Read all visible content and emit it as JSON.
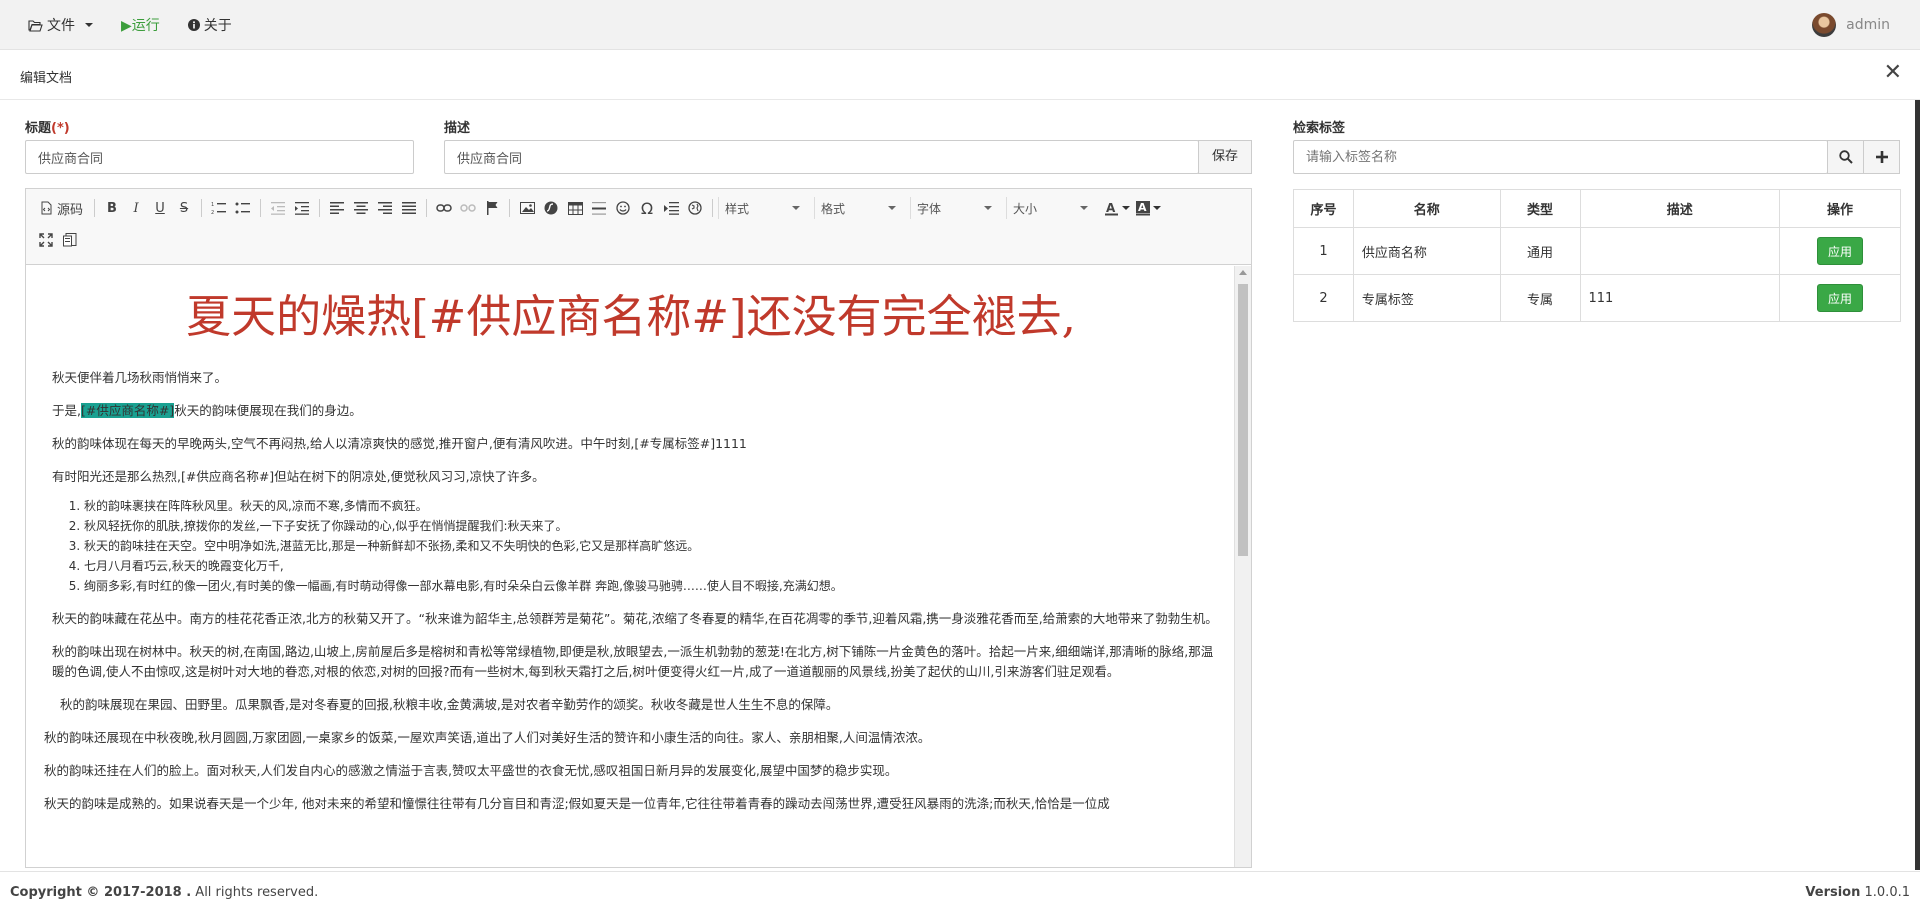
{
  "topbar": {
    "file_label": "文件",
    "run_label": "▶运行",
    "about_label": "关于",
    "user_name": "admin"
  },
  "dialog": {
    "title": "编辑文档",
    "close_label": "✕"
  },
  "form": {
    "title_label": "标题",
    "title_required": "(*)",
    "title_value": "供应商合同",
    "desc_label": "描述",
    "desc_value": "供应商合同",
    "save_label": "保存"
  },
  "editor": {
    "source_label": "源码",
    "combo_style": "样式",
    "combo_format": "格式",
    "combo_font": "字体",
    "combo_size": "大小",
    "heading": "夏天的燥热[#供应商名称#]还没有完全褪去,",
    "p1": "秋天便伴着几场秋雨悄悄来了。",
    "p2_before": "于是,",
    "p2_highlight": "[#供应商名称#]",
    "p2_after": "秋天的韵味便展现在我们的身边。",
    "p3": "秋的韵味体现在每天的早晚两头,空气不再闷热,给人以清凉爽快的感觉,推开窗户,便有清风吹进。中午时刻,[#专属标签#]1111",
    "p4": "有时阳光还是那么热烈,[#供应商名称#]但站在树下的阴凉处,便觉秋风习习,凉快了许多。",
    "list": [
      "秋的韵味裹挟在阵阵秋风里。秋天的风,凉而不寒,多情而不疯狂。",
      "秋风轻抚你的肌肤,撩拨你的发丝,一下子安抚了你躁动的心,似乎在悄悄提醒我们:秋天来了。",
      "秋天的韵味挂在天空。空中明净如洗,湛蓝无比,那是一种新鲜却不张扬,柔和又不失明快的色彩,它又是那样高旷悠远。",
      "七月八月看巧云,秋天的晚霞变化万千,",
      "绚丽多彩,有时红的像一团火,有时美的像一幅画,有时萌动得像一部水幕电影,有时朵朵白云像羊群 奔跑,像骏马驰骋……使人目不暇接,充满幻想。"
    ],
    "p5": "秋天的韵味藏在花丛中。南方的桂花花香正浓,北方的秋菊又开了。“秋来谁为韶华主,总领群芳是菊花”。菊花,浓缩了冬春夏的精华,在百花凋零的季节,迎着风霜,携一身淡雅花香而至,给萧索的大地带来了勃勃生机。",
    "p6": "秋的韵味出现在树林中。秋天的树,在南国,路边,山坡上,房前屋后多是榕树和青松等常绿植物,即便是秋,放眼望去,一派生机勃勃的葱茏!在北方,树下铺陈一片金黄色的落叶。拾起一片来,细细端详,那清晰的脉络,那温暖的色调,使人不由惊叹,这是树叶对大地的眷恋,对根的依恋,对树的回报?而有一些树木,每到秋天霜打之后,树叶便变得火红一片,成了一道道靓丽的风景线,扮美了起伏的山川,引来游客们驻足观看。",
    "p7": "秋的韵味展现在果园、田野里。瓜果飘香,是对冬春夏的回报,秋粮丰收,金黄满坡,是对农者辛勤劳作的颂奖。秋收冬藏是世人生生不息的保障。",
    "p8": "秋的韵味还展现在中秋夜晚,秋月圆圆,万家团圆,一桌家乡的饭菜,一屋欢声笑语,道出了人们对美好生活的赞许和小康生活的向往。家人、亲朋相聚,人间温情浓浓。",
    "p9": "秋的韵味还挂在人们的脸上。面对秋天,人们发自内心的感激之情溢于言表,赞叹太平盛世的衣食无忧,感叹祖国日新月异的发展变化,展望中国梦的稳步实现。",
    "p10": "秋天的韵味是成熟的。如果说春天是一个少年, 他对未来的希望和憧憬往往带有几分盲目和青涩;假如夏天是一位青年,它往往带着青春的躁动去闯荡世界,遭受狂风暴雨的洗涤;而秋天,恰恰是一位成"
  },
  "tags": {
    "label": "检索标签",
    "search_placeholder": "请输入标签名称",
    "headers": [
      "序号",
      "名称",
      "类型",
      "描述",
      "操作"
    ],
    "rows": [
      {
        "index": "1",
        "name": "供应商名称",
        "type": "通用",
        "desc": "",
        "action": "应用"
      },
      {
        "index": "2",
        "name": "专属标签",
        "type": "专属",
        "desc": "111",
        "action": "应用"
      }
    ]
  },
  "footer": {
    "copyright_bold": "Copyright © 2017-2018 .",
    "copyright_rest": " All rights reserved.",
    "version_label": "Version",
    "version_value": " 1.0.0.1"
  },
  "colors": {
    "run_green": "#3c9d3c",
    "heading_red": "#c0392b",
    "highlight_teal": "#1aa191",
    "apply_green": "#3aa846"
  }
}
